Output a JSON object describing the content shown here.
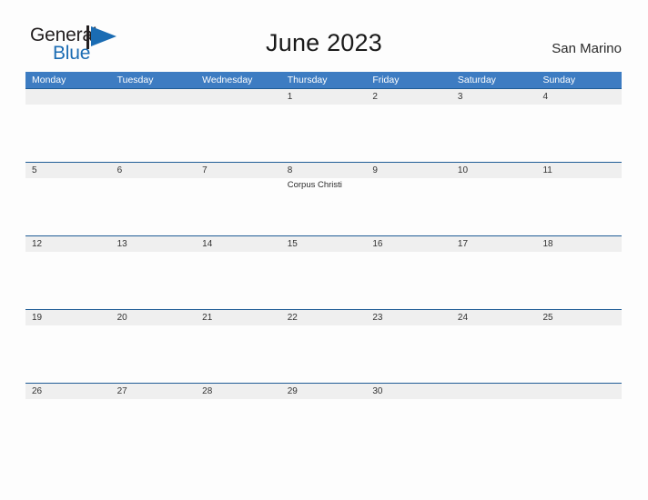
{
  "brand": {
    "name_part1": "General",
    "name_part2": "Blue",
    "flag_icon": "blue-flag-triangle-icon",
    "color_dark": "#231f20",
    "color_blue": "#1b6cb3"
  },
  "header": {
    "title": "June 2023",
    "location": "San Marino"
  },
  "calendar": {
    "month": "June",
    "year": "2023",
    "accent_color": "#3d7cc2",
    "band_color": "#efefef",
    "rule_color": "#1f5c96",
    "weekdays": [
      "Monday",
      "Tuesday",
      "Wednesday",
      "Thursday",
      "Friday",
      "Saturday",
      "Sunday"
    ],
    "weeks": [
      {
        "days": [
          {
            "num": "",
            "events": []
          },
          {
            "num": "",
            "events": []
          },
          {
            "num": "",
            "events": []
          },
          {
            "num": "1",
            "events": []
          },
          {
            "num": "2",
            "events": []
          },
          {
            "num": "3",
            "events": []
          },
          {
            "num": "4",
            "events": []
          }
        ]
      },
      {
        "days": [
          {
            "num": "5",
            "events": []
          },
          {
            "num": "6",
            "events": []
          },
          {
            "num": "7",
            "events": []
          },
          {
            "num": "8",
            "events": [
              "Corpus Christi"
            ]
          },
          {
            "num": "9",
            "events": []
          },
          {
            "num": "10",
            "events": []
          },
          {
            "num": "11",
            "events": []
          }
        ]
      },
      {
        "days": [
          {
            "num": "12",
            "events": []
          },
          {
            "num": "13",
            "events": []
          },
          {
            "num": "14",
            "events": []
          },
          {
            "num": "15",
            "events": []
          },
          {
            "num": "16",
            "events": []
          },
          {
            "num": "17",
            "events": []
          },
          {
            "num": "18",
            "events": []
          }
        ]
      },
      {
        "days": [
          {
            "num": "19",
            "events": []
          },
          {
            "num": "20",
            "events": []
          },
          {
            "num": "21",
            "events": []
          },
          {
            "num": "22",
            "events": []
          },
          {
            "num": "23",
            "events": []
          },
          {
            "num": "24",
            "events": []
          },
          {
            "num": "25",
            "events": []
          }
        ]
      },
      {
        "days": [
          {
            "num": "26",
            "events": []
          },
          {
            "num": "27",
            "events": []
          },
          {
            "num": "28",
            "events": []
          },
          {
            "num": "29",
            "events": []
          },
          {
            "num": "30",
            "events": []
          },
          {
            "num": "",
            "events": []
          },
          {
            "num": "",
            "events": []
          }
        ]
      }
    ]
  }
}
